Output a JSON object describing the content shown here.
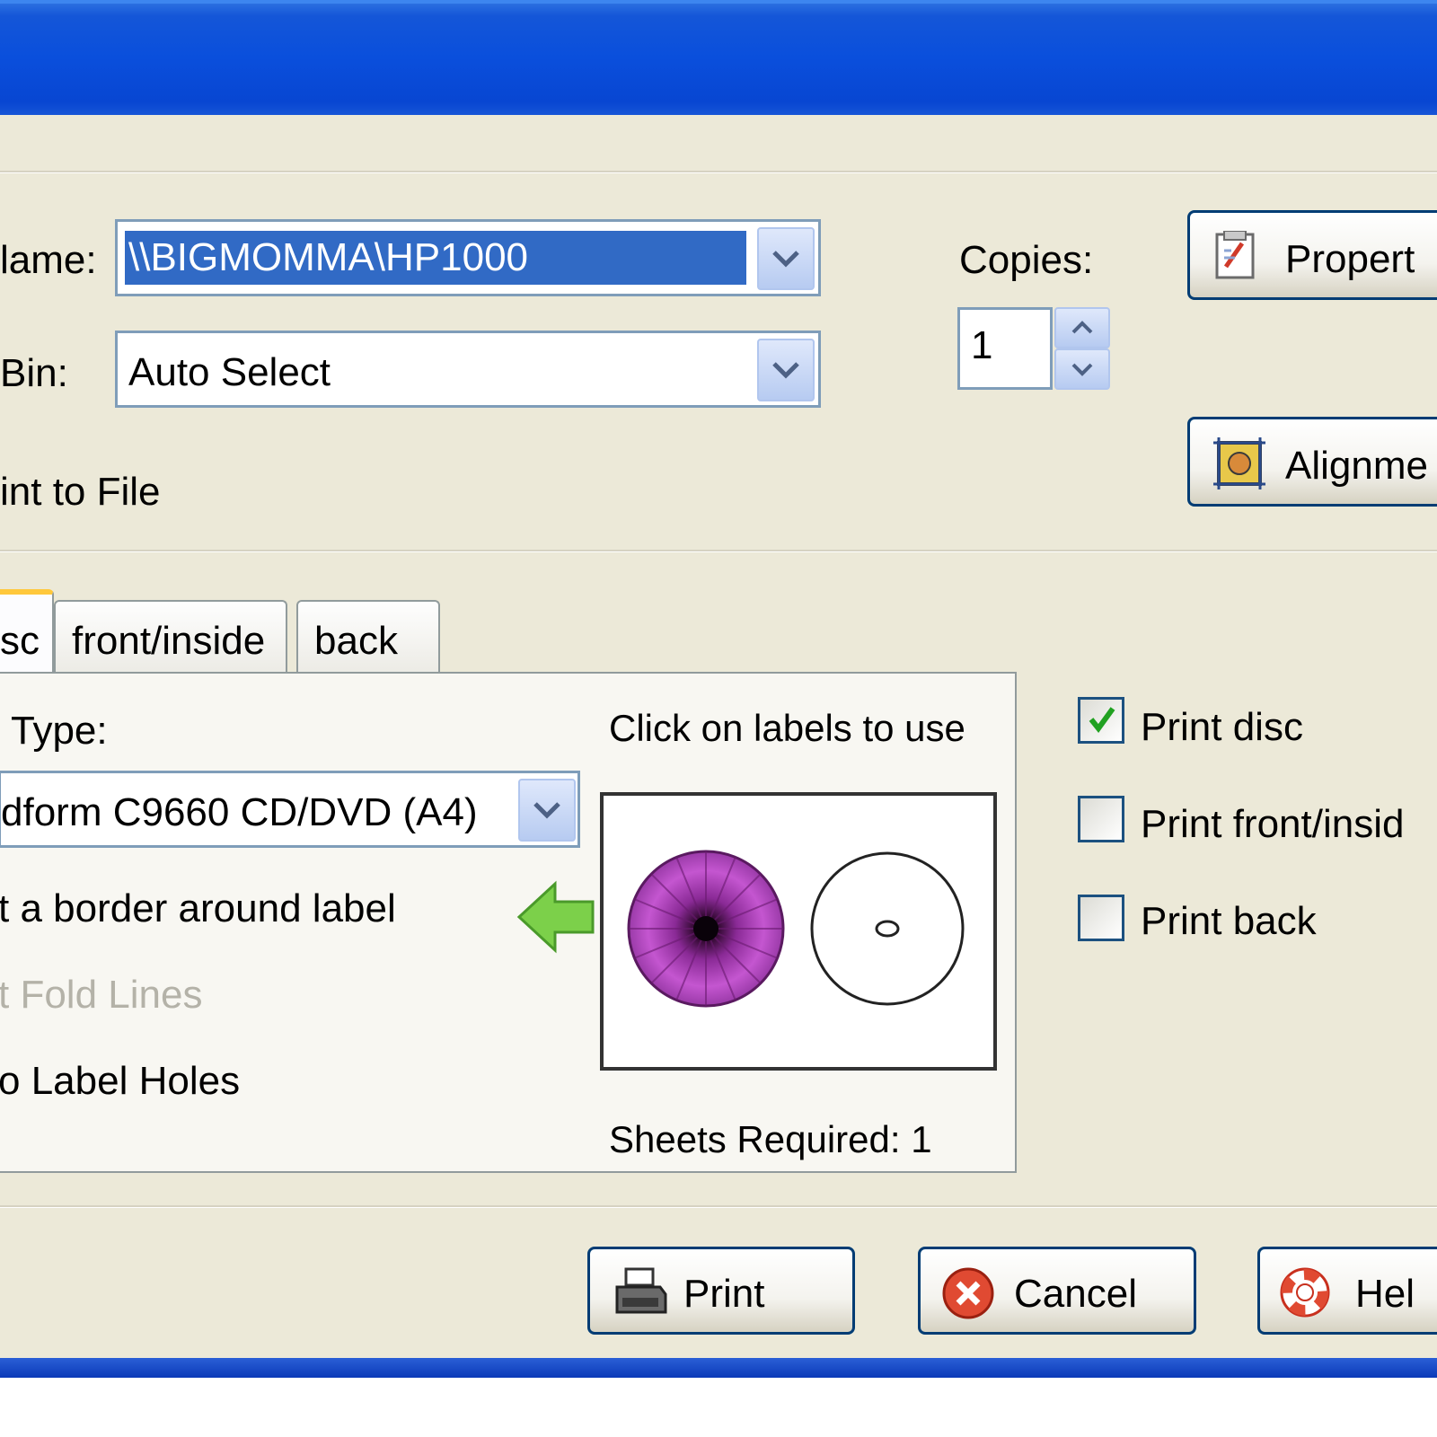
{
  "dialog": {
    "printer": {
      "name_label": "lame:",
      "name_value": "\\\\BIGMOMMA\\HP1000",
      "bin_label": "Bin:",
      "bin_value": "Auto Select",
      "print_to_file_label": "int to File",
      "copies_label": "Copies:",
      "copies_value": "1",
      "properties_button": "Propert",
      "alignment_button": "Alignme"
    },
    "tabs": [
      {
        "label": "sc",
        "active": true
      },
      {
        "label": "front/inside",
        "active": false
      },
      {
        "label": "back",
        "active": false
      }
    ],
    "disc_panel": {
      "type_label": "Type:",
      "type_value": "dform C9660 CD/DVD (A4)",
      "border_option": "t a border around label",
      "fold_lines_option": "t Fold Lines",
      "label_holes_option": "o Label Holes",
      "click_hint": "Click on labels to use",
      "sheets_required": "Sheets Required: 1"
    },
    "options": {
      "print_disc": {
        "label": "Print disc",
        "checked": true
      },
      "print_front_inside": {
        "label": "Print front/insid",
        "checked": false
      },
      "print_back": {
        "label": "Print back",
        "checked": false
      }
    },
    "buttons": {
      "print": "Print",
      "cancel": "Cancel",
      "help": "Hel"
    }
  },
  "icons": {
    "properties": "properties-icon",
    "alignment": "alignment-icon",
    "print": "printer-icon",
    "cancel": "cancel-icon",
    "help": "help-icon",
    "arrow": "green-arrow-left-icon"
  },
  "colors": {
    "titlebar": "#0a4fdc",
    "dialog_bg": "#ece9d8",
    "selection": "#316ac5",
    "disc_label": "#b44fbf"
  }
}
